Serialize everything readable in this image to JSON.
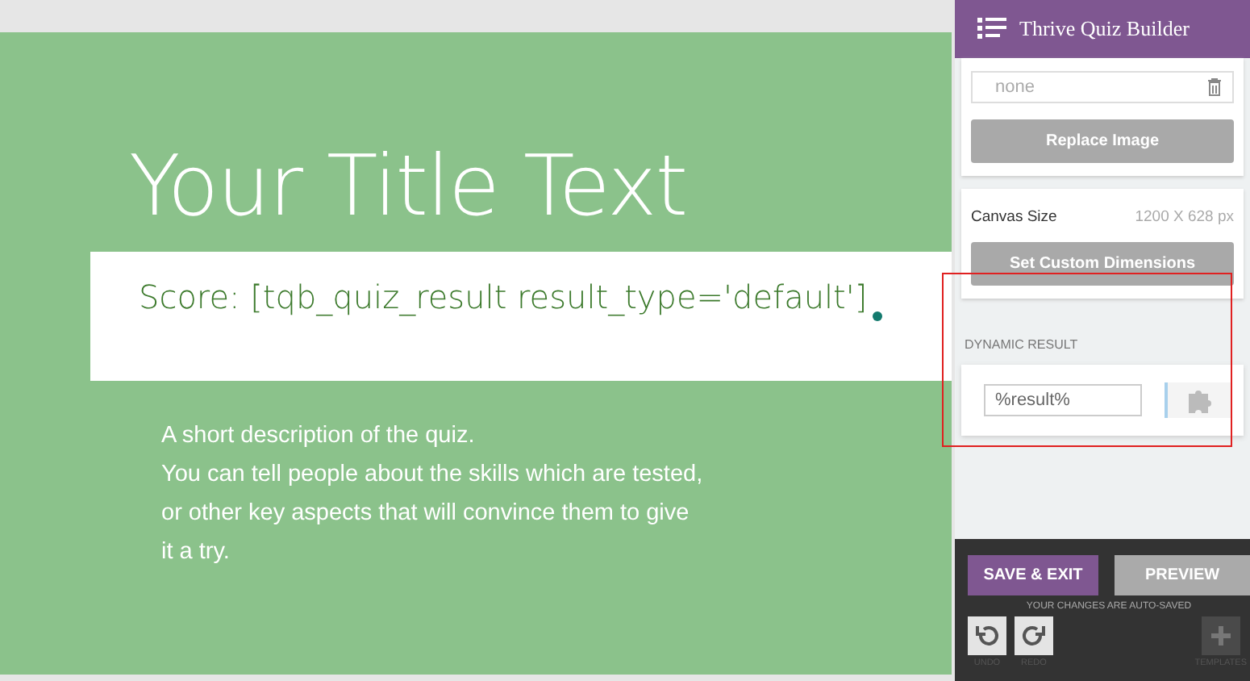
{
  "canvas": {
    "title": "Your Title Text",
    "score_text": "Score: [tqb_quiz_result result_type='default']",
    "description": [
      "A short description of the quiz.",
      "You can tell people about the skills which are tested,",
      "or other key aspects that will convince them to give",
      "it a try."
    ]
  },
  "sidebar": {
    "header": {
      "title": "Thrive Quiz Builder"
    },
    "image": {
      "value": "none",
      "button": "Replace Image"
    },
    "canvas_size": {
      "label": "Canvas Size",
      "value": "1200 X 628 px",
      "button": "Set Custom Dimensions"
    },
    "dynamic_result": {
      "heading": "DYNAMIC RESULT",
      "value": "%result%",
      "highlighted": true
    },
    "footer": {
      "save": "SAVE & EXIT",
      "preview": "PREVIEW",
      "note": "YOUR CHANGES ARE AUTO-SAVED",
      "tools": [
        {
          "kind": "undo",
          "label": "UNDO"
        },
        {
          "kind": "redo",
          "label": "REDO"
        },
        {
          "kind": "templates",
          "label": "TEMPLATES"
        }
      ]
    }
  }
}
